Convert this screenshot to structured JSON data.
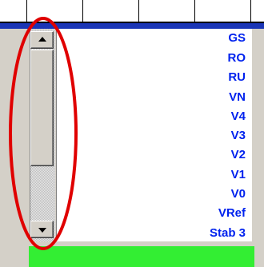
{
  "list": {
    "items": [
      "GS",
      "RO",
      "RU",
      "VN",
      "V4",
      "V3",
      "V2",
      "V1",
      "V0",
      "VRef",
      "Stab 3"
    ]
  },
  "scrollbar": {
    "up_icon": "triangle-up",
    "down_icon": "triangle-down",
    "thumb_position": 0.0,
    "visible_fraction": 0.6
  },
  "colors": {
    "header_bar": "#1a35b6",
    "list_text": "#0022ee",
    "status_bar": "#33ee33",
    "annotation_ellipse": "#e00000",
    "window_face": "#d4d0c8"
  }
}
